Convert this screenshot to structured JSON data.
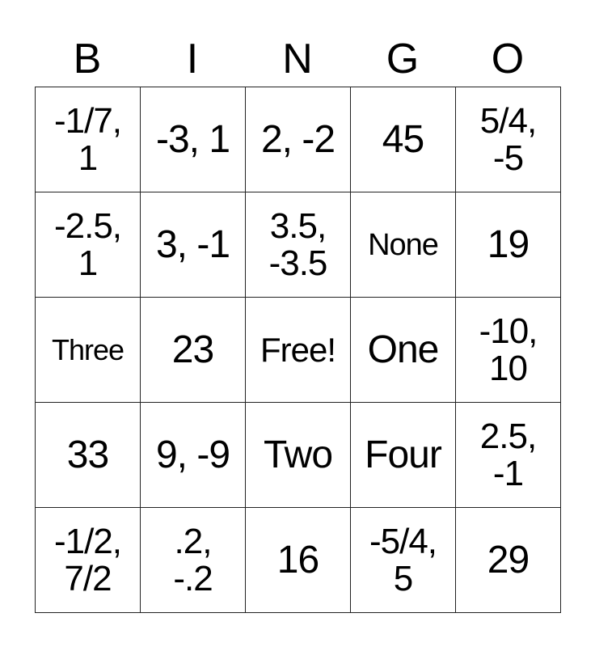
{
  "header": [
    "B",
    "I",
    "N",
    "G",
    "O"
  ],
  "rows": [
    [
      "-1/7,\n1",
      "-3, 1",
      "2, -2",
      "45",
      "5/4,\n-5"
    ],
    [
      "-2.5,\n1",
      "3, -1",
      "3.5,\n-3.5",
      "None",
      "19"
    ],
    [
      "Three",
      "23",
      "Free!",
      "One",
      "-10,\n10"
    ],
    [
      "33",
      "9, -9",
      "Two",
      "Four",
      "2.5,\n-1"
    ],
    [
      "-1/2,\n7/2",
      ".2,\n-.2",
      "16",
      "-5/4,\n5",
      "29"
    ]
  ]
}
